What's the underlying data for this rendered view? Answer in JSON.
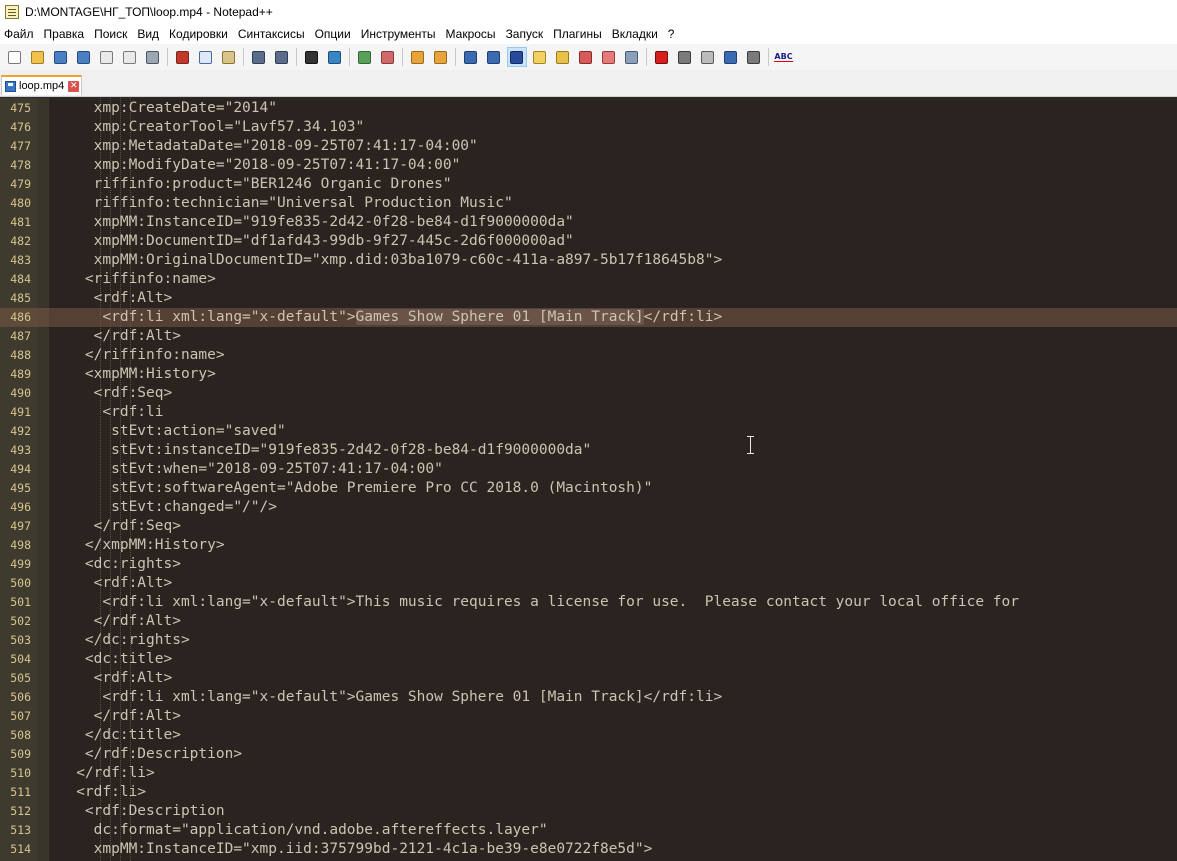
{
  "window": {
    "title": "D:\\MONTAGE\\НГ_ТОП\\loop.mp4 - Notepad++"
  },
  "menu": [
    "Файл",
    "Правка",
    "Поиск",
    "Вид",
    "Кодировки",
    "Синтаксисы",
    "Опции",
    "Инструменты",
    "Макросы",
    "Запуск",
    "Плагины",
    "Вкладки",
    "?"
  ],
  "toolbar": {
    "items": [
      {
        "name": "new-file-icon",
        "color": "#ffffff",
        "border": "#7a7a7a"
      },
      {
        "name": "open-file-icon",
        "color": "#f1c24b",
        "border": "#a07d1c"
      },
      {
        "name": "save-icon",
        "color": "#4a7fc4",
        "border": "#234b80"
      },
      {
        "name": "save-all-icon",
        "color": "#4a7fc4",
        "border": "#234b80"
      },
      {
        "name": "close-icon",
        "color": "#e9e9e9",
        "border": "#7a7a7a"
      },
      {
        "name": "close-all-icon",
        "color": "#e9e9e9",
        "border": "#7a7a7a"
      },
      {
        "name": "print-icon",
        "color": "#9aa6b2",
        "border": "#4a5562"
      },
      {
        "sep": true
      },
      {
        "name": "cut-icon",
        "color": "#c0392b",
        "border": "#7a241b"
      },
      {
        "name": "copy-icon",
        "color": "#dfe8f5",
        "border": "#4a6a9a"
      },
      {
        "name": "paste-icon",
        "color": "#d9c48a",
        "border": "#8a7430"
      },
      {
        "sep": true
      },
      {
        "name": "undo-icon",
        "color": "#5a6d8a",
        "border": "#2f3e57"
      },
      {
        "name": "redo-icon",
        "color": "#5a6d8a",
        "border": "#2f3e57"
      },
      {
        "sep": true
      },
      {
        "name": "find-icon",
        "color": "#333333",
        "border": "#111111"
      },
      {
        "name": "replace-icon",
        "color": "#3a86c4",
        "border": "#1e4e78"
      },
      {
        "sep": true
      },
      {
        "name": "zoom-in-icon",
        "color": "#5aa05a",
        "border": "#2e6a2e"
      },
      {
        "name": "zoom-out-icon",
        "color": "#d06a6a",
        "border": "#8a3a3a"
      },
      {
        "sep": true
      },
      {
        "name": "sync-vertical-icon",
        "color": "#e8a43a",
        "border": "#9a6a1a"
      },
      {
        "name": "sync-horizontal-icon",
        "color": "#e8a43a",
        "border": "#9a6a1a"
      },
      {
        "sep": true
      },
      {
        "name": "word-wrap-icon",
        "color": "#3a6ab0",
        "border": "#1e3e78"
      },
      {
        "name": "show-all-chars-icon",
        "color": "#3a6ab0",
        "border": "#1e3e78"
      },
      {
        "name": "indent-guide-icon",
        "color": "#2a4a9a",
        "border": "#13296a",
        "active": true
      },
      {
        "name": "udl-icon",
        "color": "#f3d160",
        "border": "#a08620"
      },
      {
        "name": "doc-map-icon",
        "color": "#e8c14a",
        "border": "#9a7a1a"
      },
      {
        "name": "function-list-icon",
        "color": "#d65a5a",
        "border": "#8a2a2a"
      },
      {
        "name": "folder-workspace-icon",
        "color": "#e57a7a",
        "border": "#9a3a3a"
      },
      {
        "name": "monitoring-icon",
        "color": "#8aa0b8",
        "border": "#4a5a70"
      },
      {
        "sep": true
      },
      {
        "name": "record-macro-icon",
        "color": "#d62020",
        "border": "#7a0a0a"
      },
      {
        "name": "stop-record-icon",
        "color": "#7a7a7a",
        "border": "#3a3a3a"
      },
      {
        "name": "play-macro-icon",
        "color": "#bbbbbb",
        "border": "#5a5a5a"
      },
      {
        "name": "play-multiple-icon",
        "color": "#3a6ab0",
        "border": "#1e3e78"
      },
      {
        "name": "save-macro-icon",
        "color": "#7a7a7a",
        "border": "#3a3a3a"
      },
      {
        "sep": true
      },
      {
        "name": "spell-check-icon",
        "abc": "ABC"
      }
    ]
  },
  "tab": {
    "label": "loop.mp4"
  },
  "editor": {
    "first_line": 475,
    "current_line": 486,
    "lines": [
      {
        "n": "475",
        "t": "     xmp:CreateDate=\"2014\""
      },
      {
        "n": "476",
        "t": "     xmp:CreatorTool=\"Lavf57.34.103\""
      },
      {
        "n": "477",
        "t": "     xmp:MetadataDate=\"2018-09-25T07:41:17-04:00\""
      },
      {
        "n": "478",
        "t": "     xmp:ModifyDate=\"2018-09-25T07:41:17-04:00\""
      },
      {
        "n": "479",
        "t": "     riffinfo:product=\"BER1246 Organic Drones\""
      },
      {
        "n": "480",
        "t": "     riffinfo:technician=\"Universal Production Music\""
      },
      {
        "n": "481",
        "t": "     xmpMM:InstanceID=\"919fe835-2d42-0f28-be84-d1f9000000da\""
      },
      {
        "n": "482",
        "t": "     xmpMM:DocumentID=\"df1afd43-99db-9f27-445c-2d6f000000ad\""
      },
      {
        "n": "483",
        "t": "     xmpMM:OriginalDocumentID=\"xmp.did:03ba1079-c60c-411a-a897-5b17f18645b8\">"
      },
      {
        "n": "484",
        "t": "    <riffinfo:name>"
      },
      {
        "n": "485",
        "t": "     <rdf:Alt>"
      },
      {
        "n": "486",
        "pre": "      <rdf:li xml:lang=\"x-default\">",
        "selected": "Games Show Sphere 01 [Main Track]",
        "post": "</rdf:li>"
      },
      {
        "n": "487",
        "t": "     </rdf:Alt>"
      },
      {
        "n": "488",
        "t": "    </riffinfo:name>"
      },
      {
        "n": "489",
        "t": "    <xmpMM:History>"
      },
      {
        "n": "490",
        "t": "     <rdf:Seq>"
      },
      {
        "n": "491",
        "t": "      <rdf:li"
      },
      {
        "n": "492",
        "t": "       stEvt:action=\"saved\""
      },
      {
        "n": "493",
        "t": "       stEvt:instanceID=\"919fe835-2d42-0f28-be84-d1f9000000da\""
      },
      {
        "n": "494",
        "t": "       stEvt:when=\"2018-09-25T07:41:17-04:00\""
      },
      {
        "n": "495",
        "t": "       stEvt:softwareAgent=\"Adobe Premiere Pro CC 2018.0 (Macintosh)\""
      },
      {
        "n": "496",
        "t": "       stEvt:changed=\"/\"/>"
      },
      {
        "n": "497",
        "t": "     </rdf:Seq>"
      },
      {
        "n": "498",
        "t": "    </xmpMM:History>"
      },
      {
        "n": "499",
        "t": "    <dc:rights>"
      },
      {
        "n": "500",
        "t": "     <rdf:Alt>"
      },
      {
        "n": "501",
        "t": "      <rdf:li xml:lang=\"x-default\">This music requires a license for use.  Please contact your local office for"
      },
      {
        "n": "502",
        "t": "     </rdf:Alt>"
      },
      {
        "n": "503",
        "t": "    </dc:rights>"
      },
      {
        "n": "504",
        "t": "    <dc:title>"
      },
      {
        "n": "505",
        "t": "     <rdf:Alt>"
      },
      {
        "n": "506",
        "t": "      <rdf:li xml:lang=\"x-default\">Games Show Sphere 01 [Main Track]</rdf:li>"
      },
      {
        "n": "507",
        "t": "     </rdf:Alt>"
      },
      {
        "n": "508",
        "t": "    </dc:title>"
      },
      {
        "n": "509",
        "t": "    </rdf:Description>"
      },
      {
        "n": "510",
        "t": "   </rdf:li>"
      },
      {
        "n": "511",
        "t": "   <rdf:li>"
      },
      {
        "n": "512",
        "t": "    <rdf:Description"
      },
      {
        "n": "513",
        "t": "     dc:format=\"application/vnd.adobe.aftereffects.layer\""
      },
      {
        "n": "514",
        "t": "     xmpMM:InstanceID=\"xmp.iid:375799bd-2121-4c1a-be39-e8e0722f8e5d\">"
      }
    ]
  }
}
